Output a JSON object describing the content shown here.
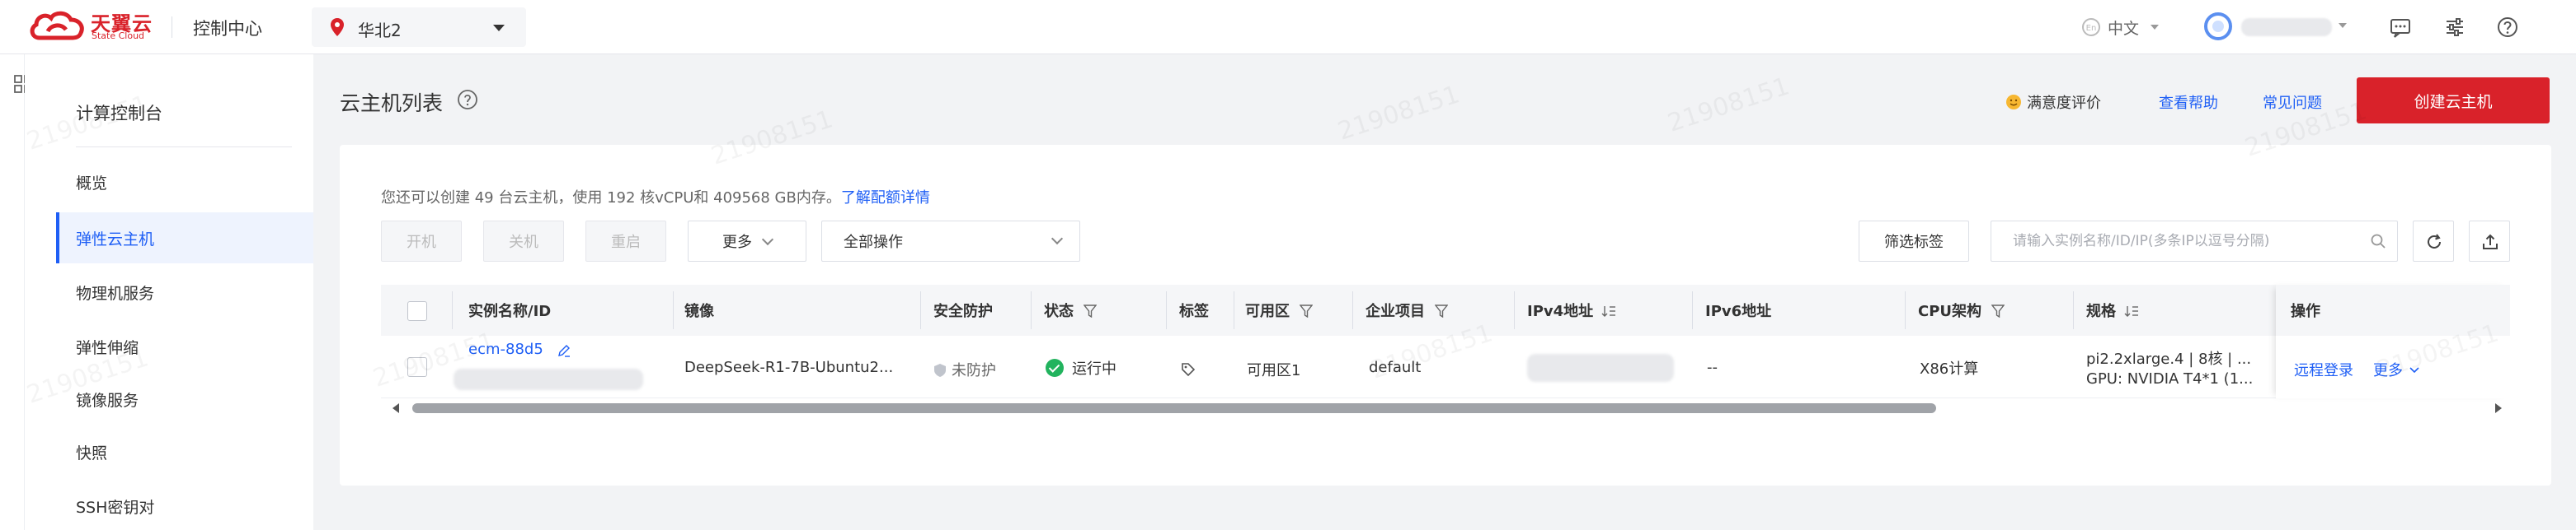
{
  "brand": {
    "name_cn": "天翼云",
    "name_en": "State Cloud",
    "color": "#d9222a"
  },
  "topbar": {
    "console_title": "控制中心",
    "region": "华北2",
    "language": "中文"
  },
  "sidebar": {
    "title": "计算控制台",
    "items": [
      {
        "label": "概览"
      },
      {
        "label": "弹性云主机",
        "active": true
      },
      {
        "label": "物理机服务"
      },
      {
        "label": "弹性伸缩"
      },
      {
        "label": "镜像服务"
      },
      {
        "label": "快照"
      },
      {
        "label": "SSH密钥对"
      }
    ]
  },
  "header": {
    "title": "云主机列表",
    "satisfaction": "满意度评价",
    "help_link": "查看帮助",
    "faq_link": "常见问题",
    "create_button": "创建云主机"
  },
  "quota": {
    "text": "您还可以创建 49 台云主机，使用 192 核vCPU和 409568 GB内存。",
    "link": "了解配额详情"
  },
  "toolbar": {
    "start": "开机",
    "stop": "关机",
    "restart": "重启",
    "more": "更多",
    "all_ops": "全部操作",
    "filter_tags": "筛选标签",
    "search_placeholder": "请输入实例名称/ID/IP(多条IP以逗号分隔)"
  },
  "table": {
    "columns": {
      "name": "实例名称/ID",
      "image": "镜像",
      "security": "安全防护",
      "status": "状态",
      "tags": "标签",
      "zone": "可用区",
      "project": "企业项目",
      "ipv4": "IPv4地址",
      "ipv6": "IPv6地址",
      "cpu_arch": "CPU架构",
      "spec": "规格",
      "ops": "操作"
    },
    "rows": [
      {
        "name": "ecm-88d5",
        "image": "DeepSeek-R1-7B-Ubuntu2...",
        "security": "未防护",
        "status": "运行中",
        "zone": "可用区1",
        "project": "default",
        "ipv6": "--",
        "cpu_arch": "X86计算",
        "spec_line1": "pi2.2xlarge.4 | 8核 | ...",
        "spec_line2": "GPU: NVIDIA T4*1 (1...",
        "op_login": "远程登录",
        "op_more": "更多"
      }
    ]
  },
  "watermark": "21908151",
  "colors": {
    "accent": "#1f5ff5",
    "running": "#22b35e"
  }
}
